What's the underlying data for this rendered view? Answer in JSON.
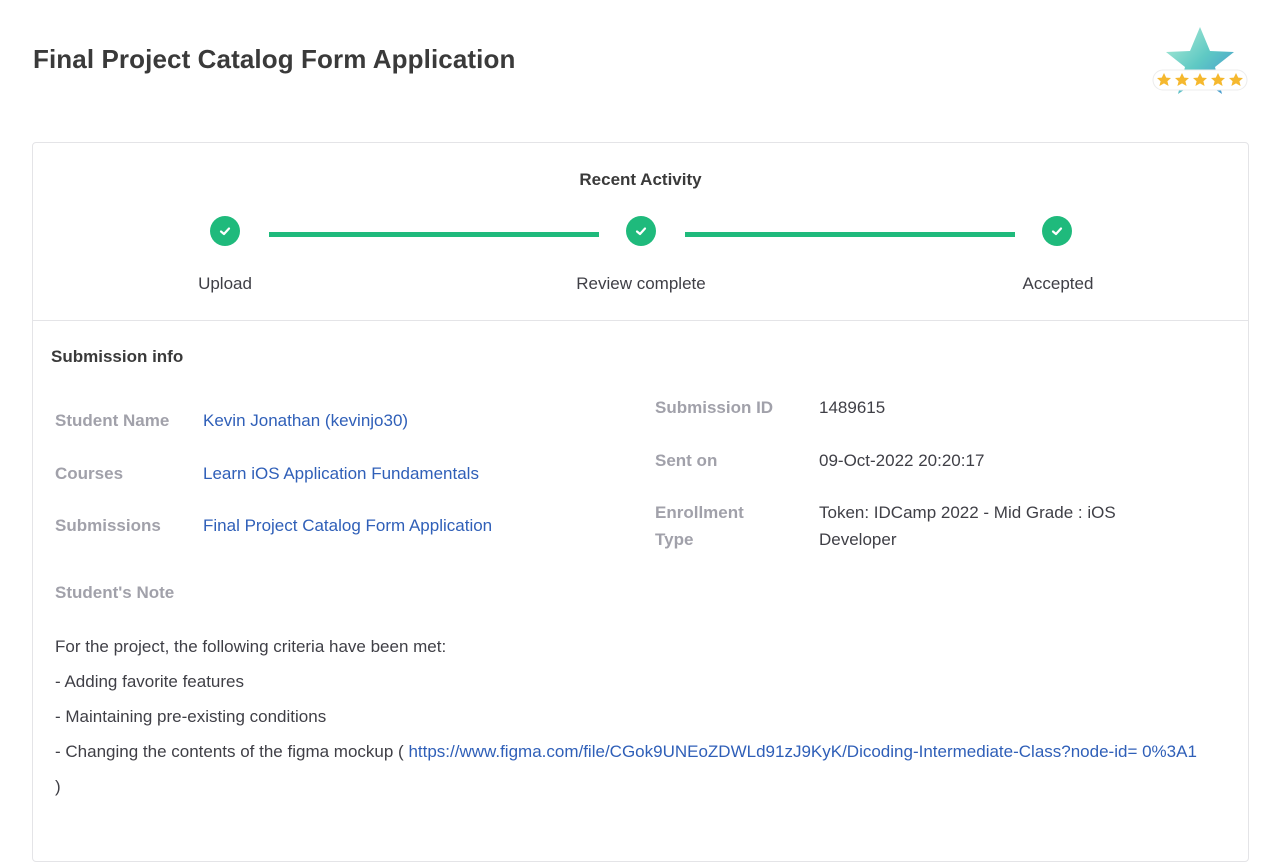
{
  "page": {
    "title": "Final Project Catalog Form Application"
  },
  "badge": {
    "icon": "star-rating-badge-icon",
    "stars": 5,
    "star_color": "#f5b82e"
  },
  "colors": {
    "accent": "#1fba7c",
    "link": "#2f5fb8",
    "muted_label": "#a1a1aa"
  },
  "activity": {
    "title": "Recent Activity",
    "steps": [
      {
        "label": "Upload",
        "icon": "check-icon"
      },
      {
        "label": "Review complete",
        "icon": "check-icon"
      },
      {
        "label": "Accepted",
        "icon": "check-icon"
      }
    ]
  },
  "submission": {
    "title": "Submission info",
    "student_name_label": "Student Name",
    "student_name": "Kevin Jonathan (kevinjo30)",
    "courses_label": "Courses",
    "course": "Learn iOS Application Fundamentals",
    "submissions_label": "Submissions",
    "submission_name": "Final Project Catalog Form Application",
    "id_label": "Submission ID",
    "id": "1489615",
    "sent_label": "Sent on",
    "sent_on": "09-Oct-2022 20:20:17",
    "enrollment_label": "Enrollment Type",
    "enrollment": "Token: IDCamp 2022 - Mid Grade : iOS Developer"
  },
  "note": {
    "label": "Student's Note",
    "intro": "For the project, the following criteria have been met:",
    "item1": "- Adding favorite features",
    "item2": "- Maintaining pre-existing conditions",
    "item3_prefix": "- Changing the contents of the figma mockup (",
    "item3_link": "https://www.figma.com/file/CGok9UNEoZDWLd91zJ9KyK/Dicoding-Intermediate-Class?node-id= 0%3A1",
    "item3_suffix": ")"
  }
}
